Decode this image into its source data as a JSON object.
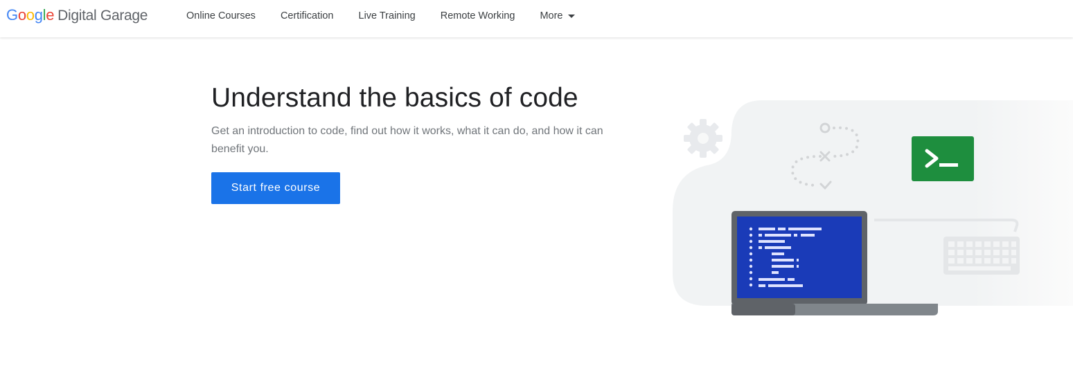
{
  "header": {
    "logo": {
      "google_letters": [
        {
          "char": "G",
          "color": "#4285F4"
        },
        {
          "char": "o",
          "color": "#EA4335"
        },
        {
          "char": "o",
          "color": "#FBBC05"
        },
        {
          "char": "g",
          "color": "#4285F4"
        },
        {
          "char": "l",
          "color": "#34A853"
        },
        {
          "char": "e",
          "color": "#EA4335"
        }
      ],
      "product_name": "Digital Garage"
    },
    "nav": {
      "online_courses": "Online Courses",
      "certification": "Certification",
      "live_training": "Live Training",
      "remote_working": "Remote Working",
      "more": "More",
      "more_icon": "caret-down-icon"
    }
  },
  "hero": {
    "title": "Understand the basics of code",
    "subtitle": "Get an introduction to code, find out how it works, what it can do, and how it can benefit you.",
    "cta_label": "Start free course",
    "accent_color": "#1a73e8"
  },
  "illustration": {
    "icons": [
      "gear-icon",
      "flow-path-icon",
      "terminal-icon",
      "laptop-code-icon",
      "keyboard-icon"
    ],
    "terminal_color": "#1e8e3e",
    "screen_color": "#1a3bb8"
  }
}
